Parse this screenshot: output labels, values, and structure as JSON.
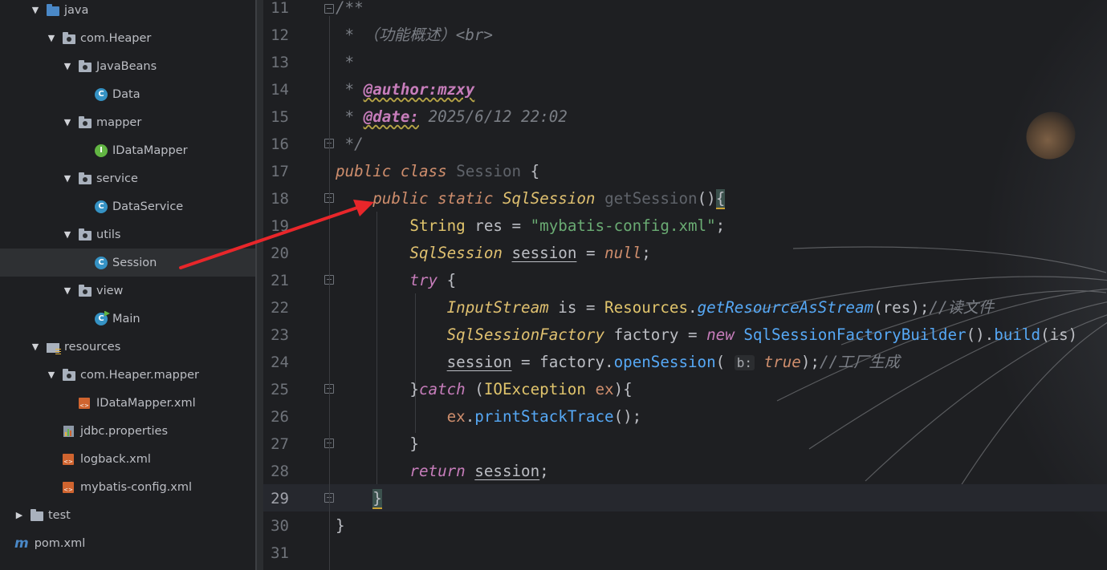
{
  "tree": {
    "items": [
      {
        "label": "java",
        "depth": 1,
        "icon": "source-folder-icon",
        "expanded": true
      },
      {
        "label": "com.Heaper",
        "depth": 2,
        "icon": "package-icon",
        "expanded": true
      },
      {
        "label": "JavaBeans",
        "depth": 3,
        "icon": "package-icon",
        "expanded": true
      },
      {
        "label": "Data",
        "depth": 4,
        "icon": "class-icon"
      },
      {
        "label": "mapper",
        "depth": 3,
        "icon": "package-icon",
        "expanded": true
      },
      {
        "label": "IDataMapper",
        "depth": 4,
        "icon": "interface-icon"
      },
      {
        "label": "service",
        "depth": 3,
        "icon": "package-icon",
        "expanded": true
      },
      {
        "label": "DataService",
        "depth": 4,
        "icon": "class-icon"
      },
      {
        "label": "utils",
        "depth": 3,
        "icon": "package-icon",
        "expanded": true
      },
      {
        "label": "Session",
        "depth": 4,
        "icon": "class-icon",
        "selected": true
      },
      {
        "label": "view",
        "depth": 3,
        "icon": "package-icon",
        "expanded": true
      },
      {
        "label": "Main",
        "depth": 4,
        "icon": "main-class-icon"
      },
      {
        "label": "resources",
        "depth": 1,
        "icon": "resources-folder-icon",
        "expanded": true
      },
      {
        "label": "com.Heaper.mapper",
        "depth": 2,
        "icon": "package-icon",
        "expanded": true
      },
      {
        "label": "IDataMapper.xml",
        "depth": 3,
        "icon": "xml-file-icon"
      },
      {
        "label": "jdbc.properties",
        "depth": 2,
        "icon": "properties-file-icon"
      },
      {
        "label": "logback.xml",
        "depth": 2,
        "icon": "xml-file-icon"
      },
      {
        "label": "mybatis-config.xml",
        "depth": 2,
        "icon": "xml-file-icon"
      },
      {
        "label": "test",
        "depth": 0,
        "icon": "folder-icon",
        "expanded": false
      },
      {
        "label": "pom.xml",
        "depth": -1,
        "icon": "maven-icon"
      }
    ]
  },
  "editor": {
    "line_numbers": [
      "11",
      "12",
      "13",
      "14",
      "15",
      "16",
      "17",
      "18",
      "19",
      "20",
      "21",
      "22",
      "23",
      "24",
      "25",
      "26",
      "27",
      "28",
      "29",
      "30",
      "31"
    ],
    "current_line": "29",
    "comment": {
      "l11": "/**",
      "l12": " * （功能概述）<br>",
      "l13": " *",
      "l14_star": " * ",
      "l14_tag": "@author:mzxy",
      "l15_star": " * ",
      "l15_tag": "@date:",
      "l15_value": " 2025/6/12 22:02",
      "l16": " */"
    },
    "code": {
      "public": "public",
      "class": "class",
      "static": "static",
      "class_name": "Session",
      "return_type": "SqlSession",
      "method_name": "getSession",
      "string_type": "String",
      "res_var": "res",
      "res_value": "\"mybatis-config.xml\"",
      "session_var": "session",
      "null_kw": "null",
      "try_kw": "try",
      "inputstream_type": "InputStream",
      "is_var": "is",
      "resources_cls": "Resources",
      "get_resource": "getResourceAsStream",
      "comment_read": "//读文件",
      "factory_type": "SqlSessionFactory",
      "factory_var": "factory",
      "new_kw": "new",
      "builder_cls": "SqlSessionFactoryBuilder",
      "build_fn": "build",
      "open_session": "openSession",
      "param_hint": "b:",
      "true_kw": "true",
      "comment_factory": "//工厂生成",
      "catch_kw": "catch",
      "ioexception": "IOException",
      "ex_var": "ex",
      "print_stack": "printStackTrace",
      "return_kw": "return"
    }
  }
}
